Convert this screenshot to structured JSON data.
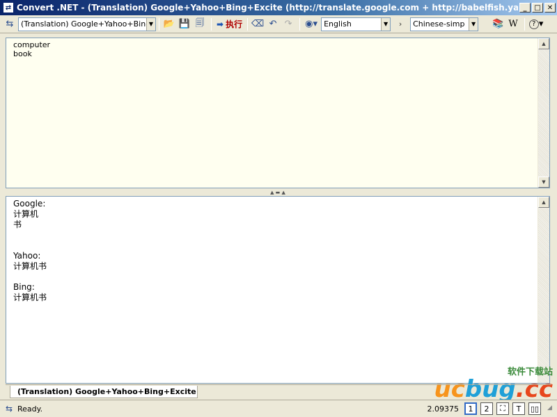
{
  "window": {
    "title": "Convert .NET - (Translation) Google+Yahoo+Bing+Excite (http://translate.google.com + http://babelfish.yahoo.com + http://..."
  },
  "toolbar": {
    "service_combo": "(Translation) Google+Yahoo+Bing+E",
    "execute_label": "执行",
    "source_language": "English",
    "target_language": "Chinese-simp",
    "wiki_label": "W",
    "help_label": "?"
  },
  "input": {
    "text": "computer\nbook"
  },
  "output": {
    "text": "Google:\n计算机\n书\n\n\nYahoo:\n计算机书\n\nBing:\n计算机书"
  },
  "tabs": [
    {
      "label": "(Translation) Google+Yahoo+Bing+Excite"
    }
  ],
  "status": {
    "text": "Ready.",
    "value": "2.09375",
    "page_buttons": [
      "1",
      "2",
      "T"
    ]
  },
  "watermark": {
    "top": "软件下载站",
    "part_a": "uc",
    "part_b": "bug",
    "part_c": ".cc"
  }
}
